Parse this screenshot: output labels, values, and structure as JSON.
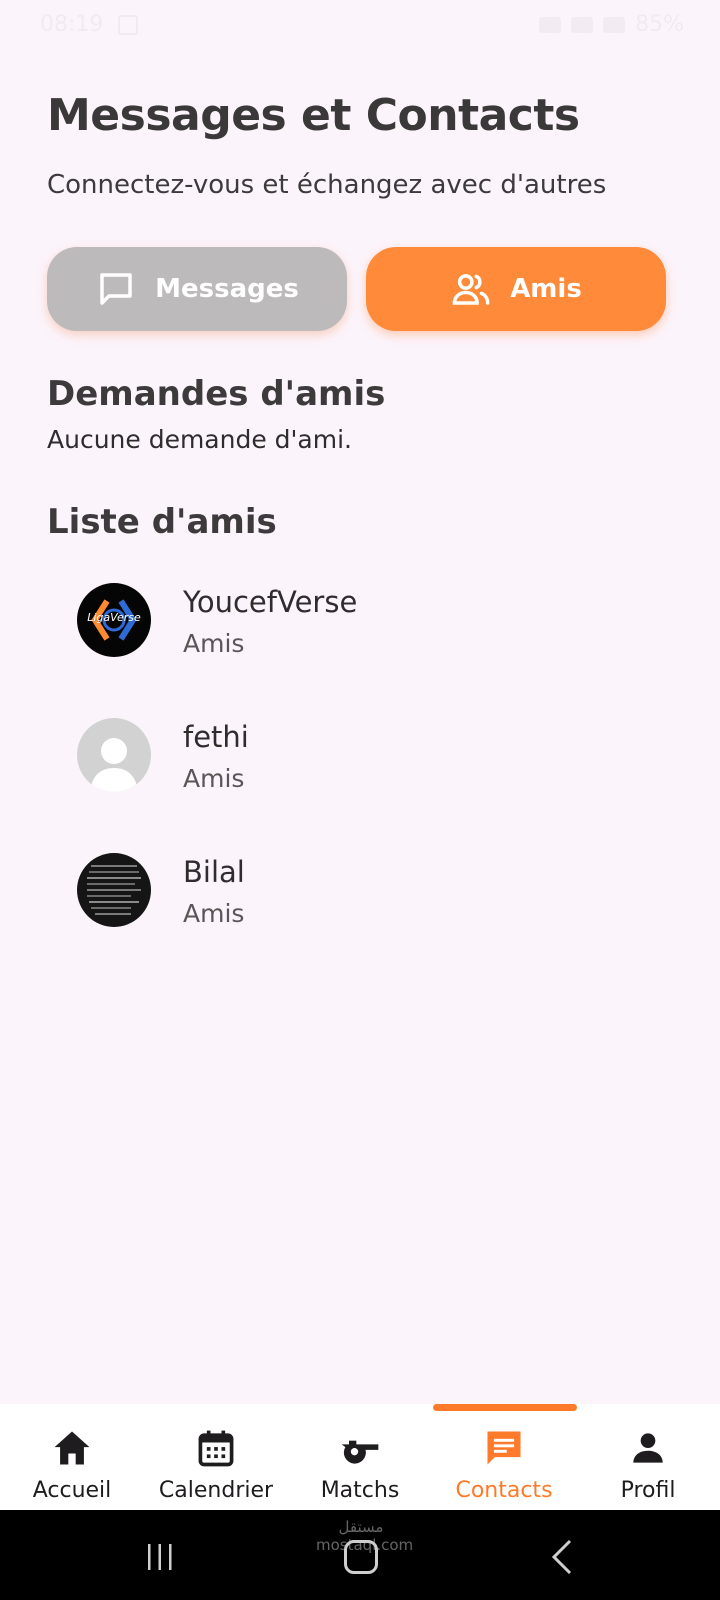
{
  "status_bar": {
    "time": "08:19",
    "battery": "85%"
  },
  "header": {
    "title": "Messages et Contacts",
    "subtitle": "Connectez-vous et échangez avec d'autres"
  },
  "tabs": [
    {
      "label": "Messages",
      "icon": "chat-bubble-icon",
      "active": false
    },
    {
      "label": "Amis",
      "icon": "people-icon",
      "active": true
    }
  ],
  "friend_requests": {
    "title": "Demandes d'amis",
    "empty_text": "Aucune demande d'ami."
  },
  "friends": {
    "title": "Liste d'amis",
    "items": [
      {
        "name": "YoucefVerse",
        "status": "Amis",
        "avatar_text": "LigaVerse"
      },
      {
        "name": "fethi",
        "status": "Amis"
      },
      {
        "name": "Bilal",
        "status": "Amis"
      }
    ]
  },
  "bottom_nav": [
    {
      "label": "Accueil",
      "icon": "home-icon"
    },
    {
      "label": "Calendrier",
      "icon": "calendar-icon"
    },
    {
      "label": "Matchs",
      "icon": "whistle-icon"
    },
    {
      "label": "Contacts",
      "icon": "message-icon",
      "active": true
    },
    {
      "label": "Profil",
      "icon": "person-icon"
    }
  ],
  "system_bar": {
    "watermark": "مستقل mostaql.com"
  },
  "colors": {
    "accent": "#ff8a3a",
    "inactive_tab": "#bcbabb",
    "background": "#fcf4fb",
    "text": "#3d3a3c"
  }
}
